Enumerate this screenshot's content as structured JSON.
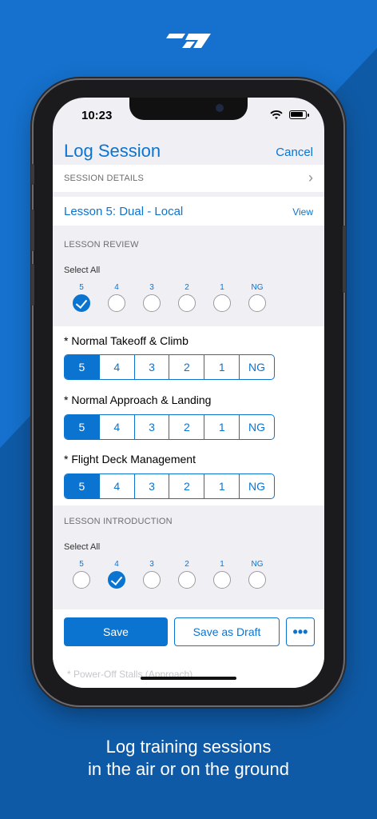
{
  "status": {
    "time": "10:23"
  },
  "nav": {
    "title": "Log Session",
    "cancel": "Cancel"
  },
  "session_details": {
    "label": "SESSION DETAILS"
  },
  "lesson": {
    "title": "Lesson 5: Dual - Local",
    "view": "View"
  },
  "lesson_review": {
    "label": "LESSON REVIEW",
    "select_all": "Select All",
    "grades": [
      "5",
      "4",
      "3",
      "2",
      "1",
      "NG"
    ],
    "selected": "5",
    "items": [
      {
        "label": "* Normal Takeoff & Climb",
        "selected": "5"
      },
      {
        "label": "* Normal Approach & Landing",
        "selected": "5"
      },
      {
        "label": "* Flight Deck Management",
        "selected": "5"
      }
    ]
  },
  "lesson_introduction": {
    "label": "LESSON INTRODUCTION",
    "select_all": "Select All",
    "grades": [
      "5",
      "4",
      "3",
      "2",
      "1",
      "NG"
    ],
    "selected": "4"
  },
  "footer": {
    "save": "Save",
    "save_draft": "Save as Draft",
    "more": "•••",
    "ghost_text": "* Power-Off Stalls (Approach)"
  },
  "caption": {
    "line1": "Log training sessions",
    "line2": "in the air or on the ground"
  },
  "colors": {
    "background": "#1466b8",
    "accent": "#0b74d1"
  }
}
